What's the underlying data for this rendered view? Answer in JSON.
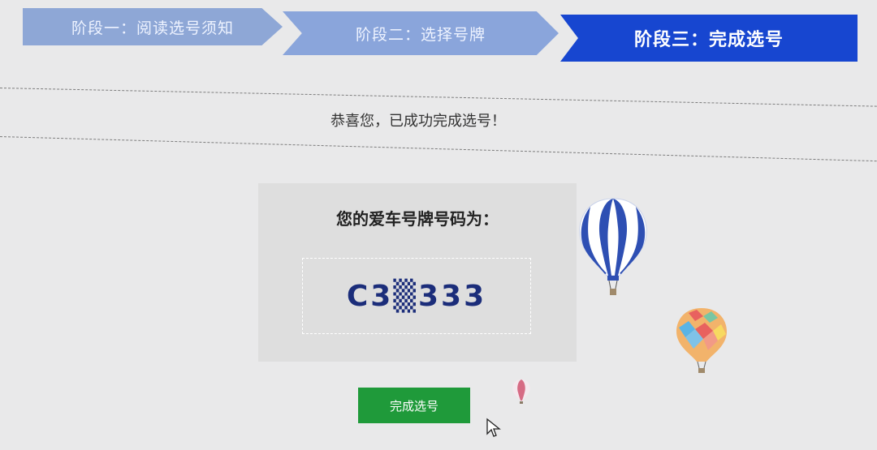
{
  "steps": [
    {
      "label": "阶段一：阅读选号须知"
    },
    {
      "label": "阶段二：选择号牌"
    },
    {
      "label": "阶段三：完成选号"
    }
  ],
  "message": "恭喜您，已成功完成选号！",
  "plate": {
    "label": "您的爱车号牌号码为：",
    "number": "C3▒333"
  },
  "button": {
    "finish_label": "完成选号"
  },
  "colors": {
    "active_step": "#1746d0",
    "inactive_step": "#8ea7d6",
    "finish_button": "#1f9a3a",
    "plate_text": "#1b2d7a"
  },
  "icons": [
    "hot-air-balloon-icon",
    "mouse-cursor-icon"
  ]
}
